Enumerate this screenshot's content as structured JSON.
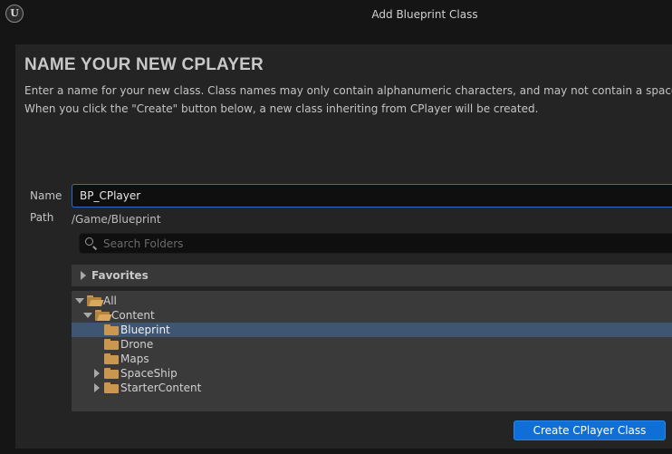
{
  "window": {
    "title": "Add Blueprint Class",
    "logo_text": "U"
  },
  "header": {
    "heading": "NAME YOUR NEW CPLAYER",
    "description_line1": "Enter a name for your new class. Class names may only contain alphanumeric characters, and may not contain a space.",
    "description_line2": "When you click the \"Create\" button below, a new class inheriting from CPlayer will be created."
  },
  "form": {
    "name_label": "Name",
    "name_value": "BP_CPlayer",
    "path_label": "Path",
    "path_value": "/Game/Blueprint"
  },
  "search": {
    "placeholder": "Search Folders",
    "icon": "search-icon"
  },
  "favorites": {
    "label": "Favorites",
    "expanded": false
  },
  "tree": {
    "items": [
      {
        "label": "All",
        "depth": 0,
        "expander": "open",
        "folder": "open",
        "selected": false
      },
      {
        "label": "Content",
        "depth": 1,
        "expander": "open",
        "folder": "open",
        "selected": false
      },
      {
        "label": "Blueprint",
        "depth": 2,
        "expander": "none",
        "folder": "closed",
        "selected": true
      },
      {
        "label": "Drone",
        "depth": 2,
        "expander": "none",
        "folder": "closed",
        "selected": false
      },
      {
        "label": "Maps",
        "depth": 2,
        "expander": "none",
        "folder": "closed",
        "selected": false
      },
      {
        "label": "SpaceShip",
        "depth": 2,
        "expander": "closed",
        "folder": "closed",
        "selected": false
      },
      {
        "label": "StarterContent",
        "depth": 2,
        "expander": "closed",
        "folder": "closed",
        "selected": false
      }
    ]
  },
  "actions": {
    "create_label": "Create CPlayer Class"
  },
  "colors": {
    "accent": "#0f6fd6",
    "selection": "#3f5673",
    "folder": "#c9974f"
  }
}
